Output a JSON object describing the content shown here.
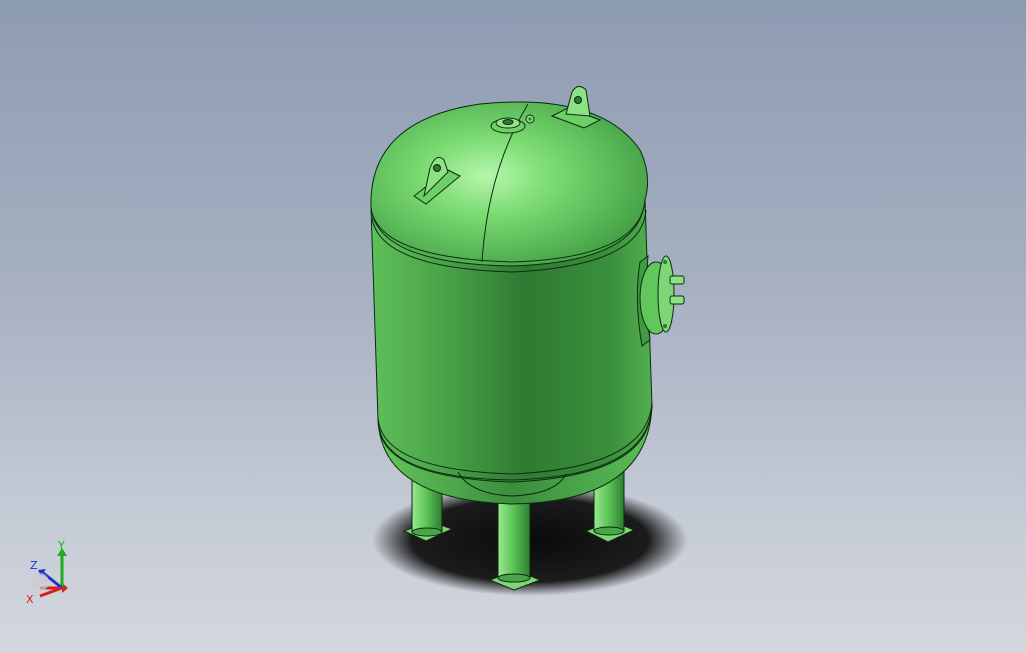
{
  "viewport": {
    "background_top": "#8d9bb2",
    "background_bottom": "#d3d7de",
    "model": {
      "name": "",
      "body_color": "#5fc85f",
      "highlight_color": "#a8f0a0",
      "shadow_color": "#2f7a33",
      "outline_color": "#0d2a10"
    }
  },
  "triad": {
    "x_label": "X",
    "y_label": "Y",
    "z_label": "Z",
    "x_color": "#d42020",
    "y_color": "#1faa1f",
    "z_color": "#2030d0"
  }
}
